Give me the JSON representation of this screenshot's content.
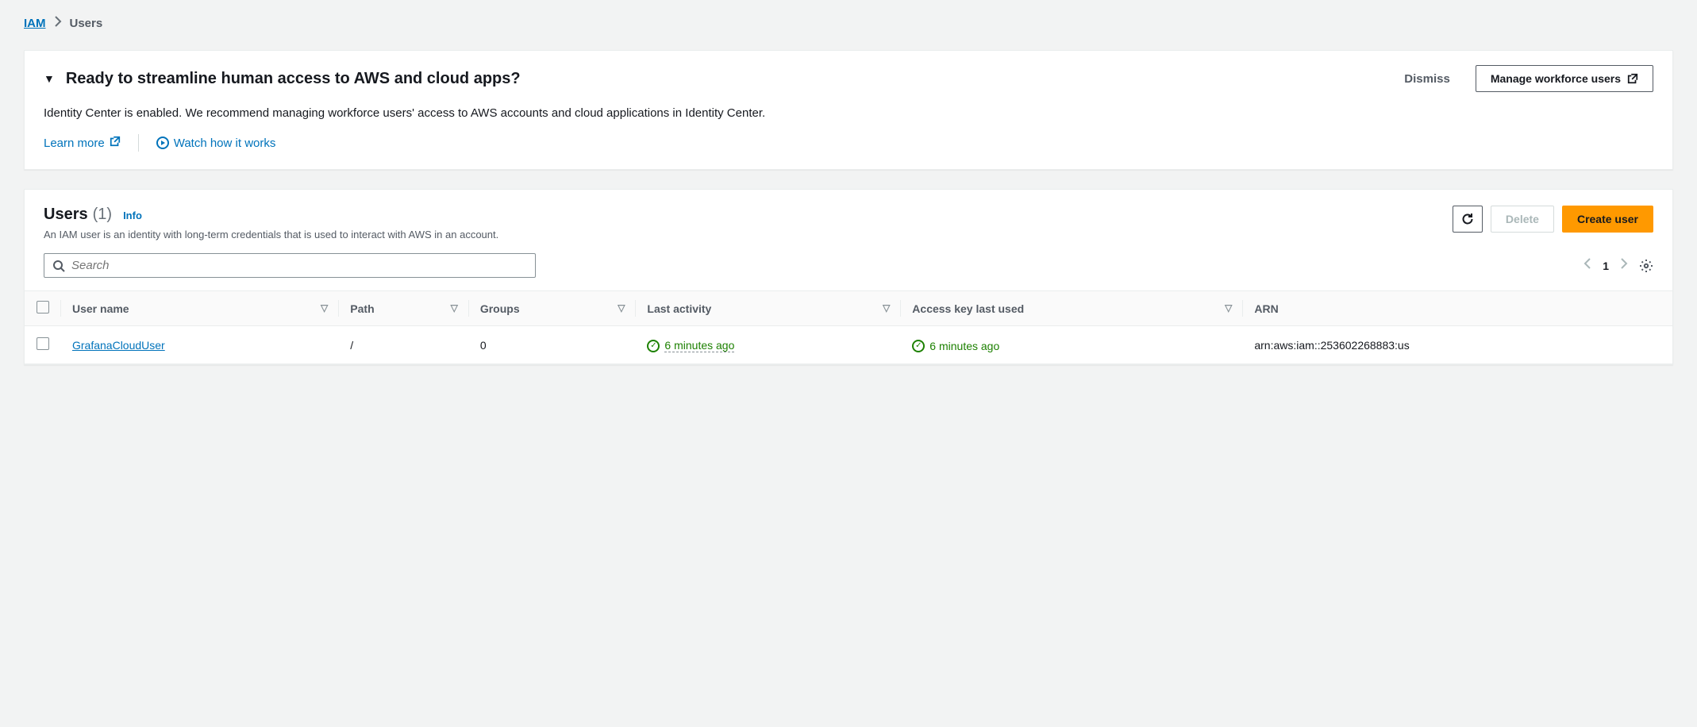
{
  "breadcrumb": {
    "root": "IAM",
    "current": "Users"
  },
  "banner": {
    "title": "Ready to streamline human access to AWS and cloud apps?",
    "dismiss": "Dismiss",
    "manage_button": "Manage workforce users",
    "body": "Identity Center is enabled. We recommend managing workforce users' access to AWS accounts and cloud applications in Identity Center.",
    "learn_more": "Learn more",
    "watch": "Watch how it works"
  },
  "users": {
    "title": "Users",
    "count": "(1)",
    "info": "Info",
    "desc": "An IAM user is an identity with long-term credentials that is used to interact with AWS in an account.",
    "delete": "Delete",
    "create": "Create user",
    "search_placeholder": "Search",
    "page": "1",
    "columns": {
      "user_name": "User name",
      "path": "Path",
      "groups": "Groups",
      "last_activity": "Last activity",
      "access_key": "Access key last used",
      "arn": "ARN"
    },
    "rows": [
      {
        "user_name": "GrafanaCloudUser",
        "path": "/",
        "groups": "0",
        "last_activity": "6 minutes ago",
        "access_key": "6 minutes ago",
        "arn": "arn:aws:iam::253602268883:us"
      }
    ]
  }
}
